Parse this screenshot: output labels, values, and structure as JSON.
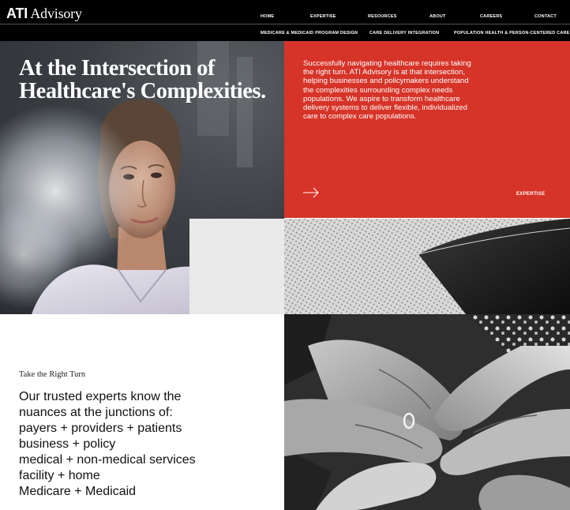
{
  "brand": {
    "logo_bold": "ATI",
    "logo_rest": " Advisory"
  },
  "nav": {
    "primary": [
      "HOME",
      "EXPERTISE",
      "RESOURCES",
      "ABOUT",
      "CAREERS",
      "CONTACT"
    ],
    "secondary": [
      "MEDICARE & MEDICAID PROGRAM DESIGN",
      "CARE DELIVERY INTEGRATION",
      "POPULATION HEALTH & PERSON-CENTERED CARE"
    ]
  },
  "hero": {
    "title_line1": "At the Intersection of",
    "title_line2": "Healthcare's Complexities.",
    "panel_text": "Successfully navigating healthcare requires taking the right turn. ATI Advisory is at that intersection, helping businesses and policymakers understand the complexities surrounding complex needs populations. We aspire to transform healthcare delivery systems to deliver flexible, individualized care to complex care populations.",
    "cta_label": "EXPERTISE"
  },
  "intro": {
    "eyebrow": "Take the Right Turn",
    "lines": [
      "Our trusted experts know the",
      "nuances at the junctions of:",
      "payers + providers + patients",
      "business + policy",
      "medical + non-medical services",
      "facility + home",
      "Medicare + Medicaid"
    ]
  },
  "colors": {
    "accent": "#d63428",
    "header": "#000000"
  }
}
